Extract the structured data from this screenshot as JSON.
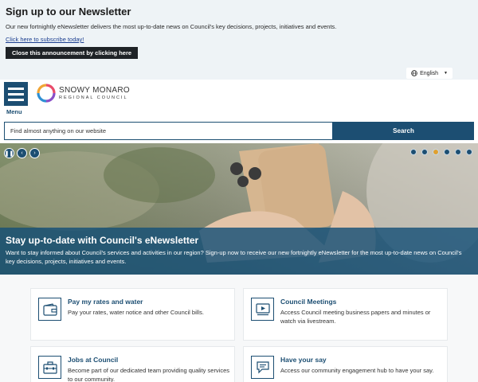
{
  "announcement": {
    "title": "Sign up to our Newsletter",
    "text": "Our new fortnightly eNewsletter delivers the most up-to-date news on Council's key decisions, projects, initiatives and events.",
    "subscribe_link": "Click here to subscribe today!",
    "close_label": "Close this announcement by clicking here"
  },
  "language": {
    "selected": "English"
  },
  "header": {
    "menu_label": "Menu",
    "logo_line1": "SNOWY MONARO",
    "logo_line2": "REGIONAL COUNCIL"
  },
  "search": {
    "placeholder": "Find almost anything on our website",
    "button_label": "Search"
  },
  "hero": {
    "title": "Stay up-to-date with Council's eNewsletter",
    "text": "Want to stay informed about Council's services and activities in our region? Sign-up now to receive our new fortnightly eNewsletter for the most up-to-date news on Council's key decisions, projects, initiatives and events.",
    "slide_count": 6,
    "active_slide": 3
  },
  "tiles": [
    {
      "title": "Pay my rates and water",
      "text": "Pay your rates, water notice and other Council bills.",
      "icon": "wallet-icon"
    },
    {
      "title": "Council Meetings",
      "text": "Access Council meeting business papers and minutes or watch via livestream.",
      "icon": "video-player-icon"
    },
    {
      "title": "Jobs at Council",
      "text": "Become part of our dedicated team providing quality services to our community.",
      "icon": "briefcase-icon"
    },
    {
      "title": "Have your say",
      "text": "Access our community engagement hub to have your say.",
      "icon": "speech-bubble-icon"
    }
  ],
  "colors": {
    "brand": "#1c4e72",
    "accent": "#e0a030",
    "announcement_bg": "#eef3f6"
  }
}
